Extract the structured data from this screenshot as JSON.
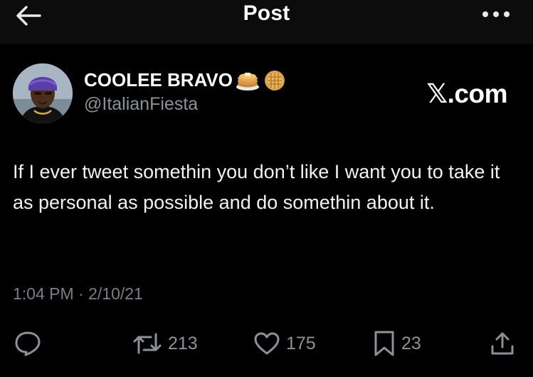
{
  "header": {
    "title": "Post",
    "back_icon": "arrow-left-icon",
    "more_icon": "more-horizontal-icon"
  },
  "post": {
    "author": {
      "display_name": "COOLEE BRAVO",
      "emojis": [
        "pancakes-emoji",
        "waffle-emoji"
      ],
      "handle": "@ItalianFiesta"
    },
    "source_logo": "𝕏.com",
    "text": "If I ever tweet somethin you don’t like I want you to take it as personal as possible and do somethin about it.",
    "timestamp": "1:04 PM · 2/10/21"
  },
  "actions": {
    "reply": {
      "icon": "reply-icon",
      "count": ""
    },
    "repost": {
      "icon": "repost-icon",
      "count": "213"
    },
    "like": {
      "icon": "heart-icon",
      "count": "175"
    },
    "bookmark": {
      "icon": "bookmark-icon",
      "count": "23"
    },
    "share": {
      "icon": "share-icon",
      "count": ""
    }
  },
  "colors": {
    "background": "#000000",
    "header_background": "#0c0c0c",
    "text_primary": "#e7e9ea",
    "text_secondary": "#8b9298"
  }
}
